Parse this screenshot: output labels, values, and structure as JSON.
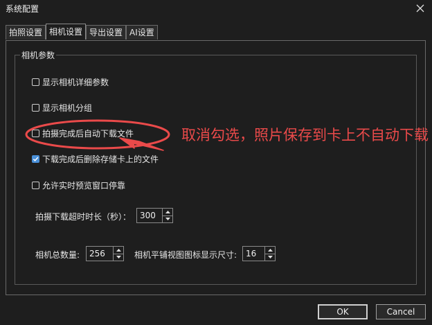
{
  "window": {
    "title": "系统配置"
  },
  "tabs": [
    {
      "label": "拍照设置",
      "active": false
    },
    {
      "label": "相机设置",
      "active": true
    },
    {
      "label": "导出设置",
      "active": false
    },
    {
      "label": "AI设置",
      "active": false
    }
  ],
  "group": {
    "title": "相机参数"
  },
  "options": [
    {
      "label": "显示相机详细参数",
      "checked": false
    },
    {
      "label": "显示相机分组",
      "checked": false
    },
    {
      "label": "拍摄完成后自动下载文件",
      "checked": false
    },
    {
      "label": "下载完成后删除存储卡上的文件",
      "checked": true
    },
    {
      "label": "允许实时预览窗口停靠",
      "checked": false
    }
  ],
  "fields": {
    "timeout_label": "拍摄下载超时时长（秒）：",
    "timeout_value": "300",
    "camera_count_label": "相机总数量:",
    "camera_count_value": "256",
    "icon_size_label": "相机平铺视图图标显示尺寸:",
    "icon_size_value": "16"
  },
  "buttons": {
    "ok": "OK",
    "cancel": "Cancel"
  },
  "annotation": {
    "text": "取消勾选，照片保存到卡上不自动下载",
    "color": "#ea4a4a"
  },
  "colors": {
    "background": "#1e1e1e",
    "check_accent": "#4a90d9"
  },
  "icons": {
    "close": "close-icon",
    "check": "checkmark-icon",
    "up": "chevron-up-icon",
    "down": "chevron-down-icon"
  }
}
